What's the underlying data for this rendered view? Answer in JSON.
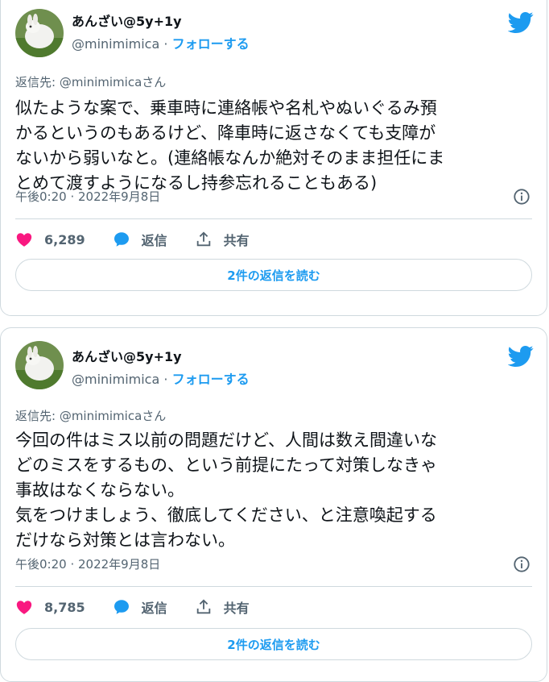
{
  "tweets": [
    {
      "name": "あんざい@5y+1y",
      "handle": "@minimimica",
      "separator": "·",
      "follow_label": "フォローする",
      "reply_to": "返信先: @minimimicaさん",
      "text": "似たような案で、乗車時に連絡帳や名札やぬいぐるみ預\nかるというのもあるけど、降車時に返さなくても支障が\nないから弱いなと。(連絡帳なんか絶対そのまま担任にま\nとめて渡すようになるし持参忘れることもある)",
      "timestamp": "午後0:20 · 2022年9月8日",
      "likes": "6,289",
      "reply_label": "返信",
      "share_label": "共有",
      "read_replies_label": "2件の返信を読む"
    },
    {
      "name": "あんざい@5y+1y",
      "handle": "@minimimica",
      "separator": "·",
      "follow_label": "フォローする",
      "reply_to": "返信先: @minimimicaさん",
      "text": "今回の件はミス以前の問題だけど、人間は数え間違いな\nどのミスをするもの、という前提にたって対策しなきゃ\n事故はなくならない。\n気をつけましょう、徹底してください、と注意喚起する\nだけなら対策とは言わない。",
      "timestamp": "午後0:20 · 2022年9月8日",
      "likes": "8,785",
      "reply_label": "返信",
      "share_label": "共有",
      "read_replies_label": "2件の返信を読む"
    }
  ],
  "colors": {
    "accent": "#1d9bf0",
    "like": "#f91880",
    "muted": "#536471",
    "border": "#cfd9de"
  },
  "icons": [
    "twitter-bird-icon",
    "info-icon",
    "heart-icon",
    "reply-bubble-icon",
    "share-upload-icon"
  ]
}
